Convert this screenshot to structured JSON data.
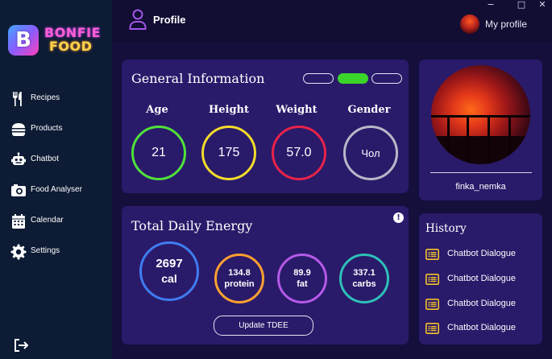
{
  "app": {
    "logo_badge": "B",
    "logo_line1": "BONFIE",
    "logo_line2": "FOOD"
  },
  "sidebar": {
    "items": [
      {
        "label": "Recipes",
        "icon": "fork-knife-icon"
      },
      {
        "label": "Products",
        "icon": "burger-icon"
      },
      {
        "label": "Chatbot",
        "icon": "robot-icon"
      },
      {
        "label": "Food Analyser",
        "icon": "camera-icon"
      },
      {
        "label": "Calendar",
        "icon": "calendar-icon"
      },
      {
        "label": "Settings",
        "icon": "gear-icon"
      }
    ],
    "logout_icon": "logout-icon"
  },
  "header": {
    "title": "Profile",
    "my_profile_label": "My profile"
  },
  "window_controls": {
    "minimize": "−",
    "maximize": "□",
    "close": "✕"
  },
  "general_info": {
    "title": "General Information",
    "toggles": [
      false,
      true,
      false
    ],
    "stats": [
      {
        "label": "Age",
        "value": "21",
        "color": "#4fe23a"
      },
      {
        "label": "Height",
        "value": "175",
        "color": "#f2dc2a"
      },
      {
        "label": "Weight",
        "value": "57.0",
        "color": "#e8234a"
      },
      {
        "label": "Gender",
        "value": "Чол",
        "color": "#b8b8c8"
      }
    ]
  },
  "energy": {
    "title": "Total Daily Energy",
    "info_icon": "!",
    "calories": {
      "value": "2697",
      "unit": "cal",
      "color": "#3f7cf0"
    },
    "macros": [
      {
        "value": "134.8",
        "unit": "protein",
        "color": "#ffa030"
      },
      {
        "value": "89.9",
        "unit": "fat",
        "color": "#b45ae8"
      },
      {
        "value": "337.1",
        "unit": "carbs",
        "color": "#2ec0b8"
      }
    ],
    "button_label": "Update TDEE"
  },
  "profile": {
    "username": "finka_nemka"
  },
  "history": {
    "title": "History",
    "items": [
      "Chatbot Dialogue",
      "Chatbot Dialogue",
      "Chatbot Dialogue",
      "Chatbot Dialogue"
    ]
  },
  "colors": {
    "background": "#150f3c",
    "sidebar": "#0d1b34",
    "card": "#2a1a6a",
    "accent_purple": "#a256e8",
    "toggle_on": "#3ad42a",
    "history_icon": "#f2c02a"
  }
}
